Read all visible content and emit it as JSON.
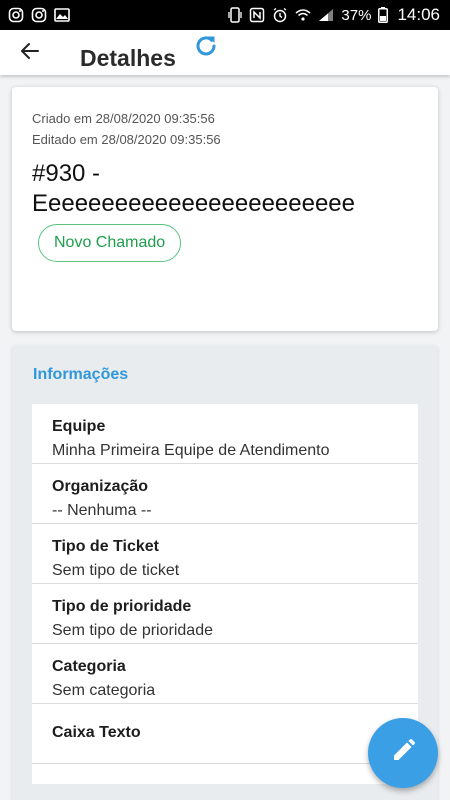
{
  "status_bar": {
    "battery_percent": "37%",
    "time": "14:06",
    "left_icons": [
      "instagram-icon",
      "instagram-icon",
      "image-icon"
    ],
    "right_icons": [
      "vibrate-icon",
      "nfc-icon",
      "alarm-icon",
      "wifi-icon",
      "signal-icon",
      "battery-icon"
    ]
  },
  "app_bar": {
    "title": "Detalhes",
    "back_icon": "arrow-left-icon",
    "refresh_icon": "refresh-icon"
  },
  "ticket": {
    "created": "Criado em 28/08/2020 09:35:56",
    "edited": "Editado em 28/08/2020 09:35:56",
    "title": "#930 - Eeeeeeeeeeeeeeeeeeeeeeee",
    "status": "Novo Chamado"
  },
  "info": {
    "heading": "Informações",
    "fields": [
      {
        "label": "Equipe",
        "value": "Minha Primeira Equipe de Atendimento"
      },
      {
        "label": "Organização",
        "value": "-- Nenhuma --"
      },
      {
        "label": "Tipo de Ticket",
        "value": "Sem tipo de ticket"
      },
      {
        "label": "Tipo de prioridade",
        "value": "Sem tipo de prioridade"
      },
      {
        "label": "Categoria",
        "value": "Sem categoria"
      },
      {
        "label": "Caixa Texto",
        "value": ""
      }
    ]
  },
  "fab": {
    "icon": "edit-pencil-icon"
  },
  "colors": {
    "accent": "#3197db",
    "fab": "#3b9fe5",
    "status_green": "#1e9e4d",
    "card_bg": "#e9ecee"
  }
}
